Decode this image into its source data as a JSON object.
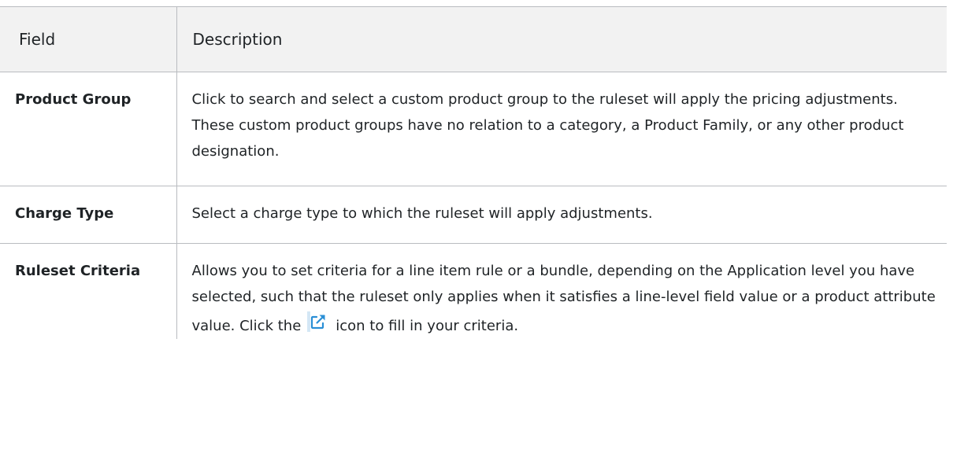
{
  "table": {
    "headers": [
      "Field",
      "Description"
    ],
    "rows": [
      {
        "field": "Product Group",
        "description": "Click to search and select a custom product group to the ruleset will apply the pricing adjustments. These custom product groups have no relation to a category, a Product Family, or any other product designation."
      },
      {
        "field": "Charge Type",
        "description": "Select a charge type to which the ruleset will apply adjustments."
      },
      {
        "field": "Ruleset Criteria",
        "description_before_icon": "Allows you to set criteria for a line item rule or a bundle, depending on the Application level you have selected, such that the ruleset only applies when it satisfies a line-level field value or a product attribute value. Click the",
        "icon": "external-link-icon",
        "description_after_icon": "icon to fill in your criteria."
      }
    ]
  },
  "colors": {
    "header_bg": "#f2f2f2",
    "border": "#b9bcc0",
    "text": "#1f2326",
    "icon_blue": "#2a8fd6"
  }
}
